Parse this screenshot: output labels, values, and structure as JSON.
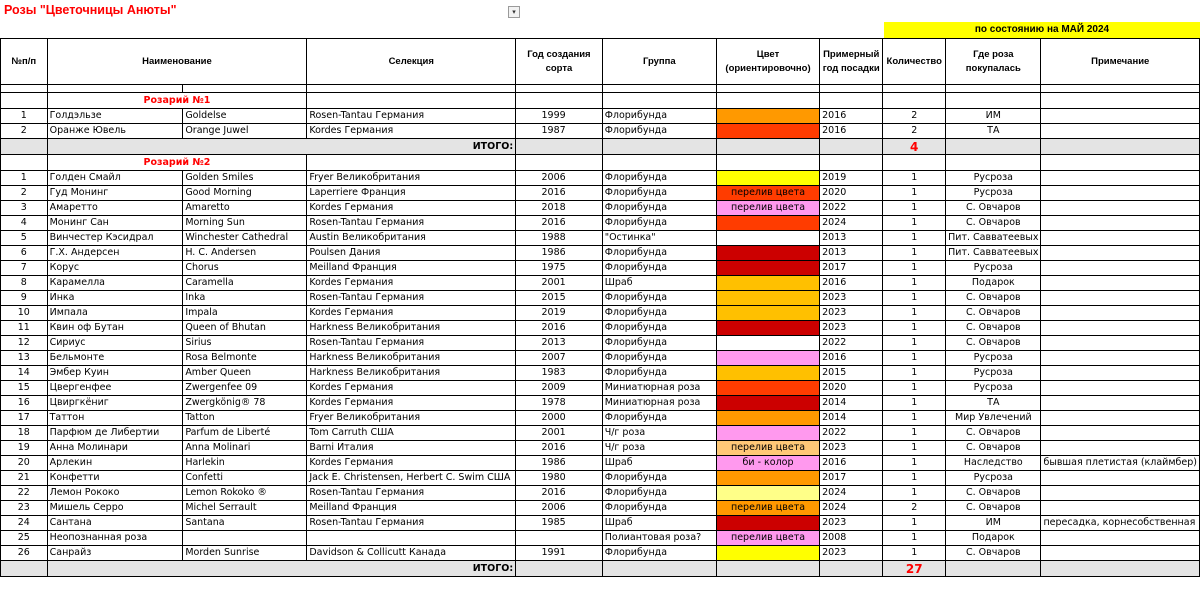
{
  "title": "Розы \"Цветочницы Анюты\"",
  "dropdown_icon": "▾",
  "status": "по состоянию на МАЙ 2024",
  "headers": {
    "num": "№п/п",
    "name": "Наименование",
    "selection": "Селекция",
    "year": "Год создания сорта",
    "group": "Группа",
    "color": "Цвет (ориентировочно)",
    "planted": "Примерный год посадки",
    "qty": "Количество",
    "bought": "Где роза покупалась",
    "note": "Примечание"
  },
  "total_label": "ИТОГО:",
  "colors": {
    "orange": "#ff9900",
    "red_orange": "#ff3c00",
    "red": "#cc0000",
    "yellow": "#ffff00",
    "gold": "#ffc000",
    "pink": "#ff99ee",
    "white": "#ffffff",
    "peach": "#ffc877",
    "light_yellow": "#ffff88",
    "none": "#ffffff"
  },
  "sections": [
    {
      "name": "Розарий №1",
      "total": "4",
      "rows": [
        {
          "n": "1",
          "ru": "Голдэльзе",
          "en": "Goldelse",
          "sel": "Rosen-Tantau Германия",
          "year": "1999",
          "group": "Флорибунда",
          "color": "orange",
          "ctext": "",
          "planted": "2016",
          "qty": "2",
          "where": "ИМ",
          "note": ""
        },
        {
          "n": "2",
          "ru": "Оранже Ювель",
          "en": "Orange Juwel",
          "sel": "Kordes Германия",
          "year": "1987",
          "group": "Флорибунда",
          "color": "red_orange",
          "ctext": "",
          "planted": "2016",
          "qty": "2",
          "where": "ТА",
          "note": ""
        }
      ]
    },
    {
      "name": "Розарий №2",
      "total": "27",
      "rows": [
        {
          "n": "1",
          "ru": "Голден Смайл",
          "en": "Golden Smiles",
          "sel": "Fryer Великобритания",
          "year": "2006",
          "group": "Флорибунда",
          "color": "yellow",
          "ctext": "",
          "planted": "2019",
          "qty": "1",
          "where": "Русроза",
          "note": ""
        },
        {
          "n": "2",
          "ru": "Гуд Монинг",
          "en": "Good Morning",
          "sel": "Laperriere Франция",
          "year": "2016",
          "group": "Флорибунда",
          "color": "red_orange",
          "ctext": "перелив цвета",
          "planted": "2020",
          "qty": "1",
          "where": "Русроза",
          "note": ""
        },
        {
          "n": "3",
          "ru": "Амаретто",
          "en": "Amaretto",
          "sel": "Kordes Германия",
          "year": "2018",
          "group": "Флорибунда",
          "color": "pink",
          "ctext": "перелив цвета",
          "planted": "2022",
          "qty": "1",
          "where": "С. Овчаров",
          "note": ""
        },
        {
          "n": "4",
          "ru": "Монинг Сан",
          "en": " Morning Sun",
          "sel": "Rosen-Tantau Германия",
          "year": "2016",
          "group": "Флорибунда",
          "color": "red_orange",
          "ctext": "",
          "planted": "2024",
          "qty": "1",
          "where": "С. Овчаров",
          "note": ""
        },
        {
          "n": "5",
          "ru": "Винчестер Кэсидрал",
          "en": "Winchester Cathedral",
          "sel": "Austin Великобритания",
          "year": "1988",
          "group": "\"Остинка\"",
          "color": "white",
          "ctext": "",
          "planted": "2013",
          "qty": "1",
          "where": "Пит. Савватеевых",
          "note": ""
        },
        {
          "n": "6",
          "ru": "Г.Х. Андерсен",
          "en": "H. C. Andersen",
          "sel": "Poulsen Дания",
          "year": "1986",
          "group": "Флорибунда",
          "color": "red",
          "ctext": "",
          "planted": "2013",
          "qty": "1",
          "where": "Пит. Савватеевых",
          "note": ""
        },
        {
          "n": "7",
          "ru": "Корус",
          "en": "Chorus",
          "sel": "Meilland Франция",
          "year": "1975",
          "group": "Флорибунда",
          "color": "red",
          "ctext": "",
          "planted": "2017",
          "qty": "1",
          "where": "Русроза",
          "note": ""
        },
        {
          "n": "8",
          "ru": "Карамелла",
          "en": "Caramella",
          "sel": "Kordes Германия",
          "year": "2001",
          "group": "Шраб",
          "color": "gold",
          "ctext": "",
          "planted": "2016",
          "qty": "1",
          "where": "Подарок",
          "note": ""
        },
        {
          "n": "9",
          "ru": "Инка",
          "en": "Inka",
          "sel": "Rosen-Tantau Германия",
          "year": "2015",
          "group": "Флорибунда",
          "color": "gold",
          "ctext": "",
          "planted": "2023",
          "qty": "1",
          "where": "С. Овчаров",
          "note": ""
        },
        {
          "n": "10",
          "ru": "Импала",
          "en": " Impala",
          "sel": "Kordes Германия",
          "year": "2019",
          "group": "Флорибунда",
          "color": "gold",
          "ctext": "",
          "planted": "2023",
          "qty": "1",
          "where": "С. Овчаров",
          "note": ""
        },
        {
          "n": "11",
          "ru": "Квин оф Бутан",
          "en": "Queen of Bhutan",
          "sel": "Harkness Великобритания",
          "year": "2016",
          "group": "Флорибунда",
          "color": "red",
          "ctext": "",
          "planted": "2023",
          "qty": "1",
          "where": "С. Овчаров",
          "note": ""
        },
        {
          "n": "12",
          "ru": "Сириус",
          "en": "Sirius",
          "sel": "Rosen-Tantau Германия",
          "year": "2013",
          "group": "Флорибунда",
          "color": "white",
          "ctext": "",
          "planted": "2022",
          "qty": "1",
          "where": "С. Овчаров",
          "note": ""
        },
        {
          "n": "13",
          "ru": "Бельмонте",
          "en": "Rosa Belmonte",
          "sel": "Harkness Великобритания",
          "year": "2007",
          "group": "Флорибунда",
          "color": "pink",
          "ctext": "",
          "planted": "2016",
          "qty": "1",
          "where": "Русроза",
          "note": ""
        },
        {
          "n": "14",
          "ru": "Эмбер Куин",
          "en": "Amber Queen",
          "sel": "Harkness Великобритания",
          "year": "1983",
          "group": "Флорибунда",
          "color": "gold",
          "ctext": "",
          "planted": "2015",
          "qty": "1",
          "where": "Русроза",
          "note": ""
        },
        {
          "n": "15",
          "ru": "Цвергенфее",
          "en": "Zwergenfee 09",
          "sel": "Kordes Германия",
          "year": "2009",
          "group": "Миниатюрная роза",
          "color": "red_orange",
          "ctext": "",
          "planted": "2020",
          "qty": "1",
          "where": "Русроза",
          "note": ""
        },
        {
          "n": "16",
          "ru": "Цвиргкёниг",
          "en": "Zwergkönig® 78",
          "sel": "Kordes Германия",
          "year": "1978",
          "group": "Миниатюрная роза",
          "color": "red",
          "ctext": "",
          "planted": "2014",
          "qty": "1",
          "where": "ТА",
          "note": ""
        },
        {
          "n": "17",
          "ru": "Таттон",
          "en": "Tatton",
          "sel": "Fryer Великобритания",
          "year": "2000",
          "group": "Флорибунда",
          "color": "orange",
          "ctext": "",
          "planted": "2014",
          "qty": "1",
          "where": "Мир Увлечений",
          "note": ""
        },
        {
          "n": "18",
          "ru": "Парфюм де Либертии",
          "en": "Parfum de Liberté",
          "sel": "Tom Carruth США",
          "year": "2001",
          "group": "Ч/г роза",
          "color": "pink",
          "ctext": "",
          "planted": "2022",
          "qty": "1",
          "where": "С. Овчаров",
          "note": ""
        },
        {
          "n": "19",
          "ru": "Анна Молинари",
          "en": "Anna Molinari",
          "sel": "Barni Италия",
          "year": "2016",
          "group": "Ч/г роза",
          "color": "peach",
          "ctext": "перелив цвета",
          "planted": "2023",
          "qty": "1",
          "where": "С. Овчаров",
          "note": ""
        },
        {
          "n": "20",
          "ru": "Арлекин",
          "en": "Harlekin",
          "sel": "Kordes Германия",
          "year": "1986",
          "group": "Шраб",
          "color": "pink",
          "ctext": "би - колор",
          "planted": "2016",
          "qty": "1",
          "where": "Наследство",
          "note": "бывшая плетистая (клаймбер)"
        },
        {
          "n": "21",
          "ru": "Конфетти",
          "en": "Confetti",
          "sel": "Jack E. Christensen, Herbert C. Swim США",
          "year": "1980",
          "group": "Флорибунда",
          "color": "orange",
          "ctext": "",
          "planted": "2017",
          "qty": "1",
          "where": "Русроза",
          "note": ""
        },
        {
          "n": "22",
          "ru": "Лемон Рококо",
          "en": "Lemon Rokoko ®",
          "sel": "Rosen-Tantau  Германия",
          "year": "2016",
          "group": "Флорибунда",
          "color": "light_yellow",
          "ctext": "",
          "planted": "2024",
          "qty": "1",
          "where": "С. Овчаров",
          "note": ""
        },
        {
          "n": "23",
          "ru": "Мишель Серро",
          "en": "Michel Serrault",
          "sel": "Meilland Франция",
          "year": "2006",
          "group": "Флорибунда",
          "color": "orange",
          "ctext": "перелив цвета",
          "planted": "2024",
          "qty": "2",
          "where": "С. Овчаров",
          "note": ""
        },
        {
          "n": "24",
          "ru": "Сантана",
          "en": "Santana",
          "sel": "Rosen-Tantau  Германия",
          "year": "1985",
          "group": "Шраб",
          "color": "red",
          "ctext": "",
          "planted": "2023",
          "qty": "1",
          "where": "ИМ",
          "note": "пересадка, корнесобственная"
        },
        {
          "n": "25",
          "ru": "Неопознанная роза",
          "en": "",
          "sel": "",
          "year": "",
          "group": "Полиантовая роза?",
          "color": "pink",
          "ctext": "перелив цвета",
          "planted": "2008",
          "qty": "1",
          "where": "Подарок",
          "note": ""
        },
        {
          "n": "26",
          "ru": "Санрайз",
          "en": "Morden Sunrise",
          "sel": "Davidson & Collicutt Канада",
          "year": "1991",
          "group": "Флорибунда",
          "color": "yellow",
          "ctext": "",
          "planted": "2023",
          "qty": "1",
          "where": "С. Овчаров",
          "note": ""
        }
      ]
    }
  ]
}
